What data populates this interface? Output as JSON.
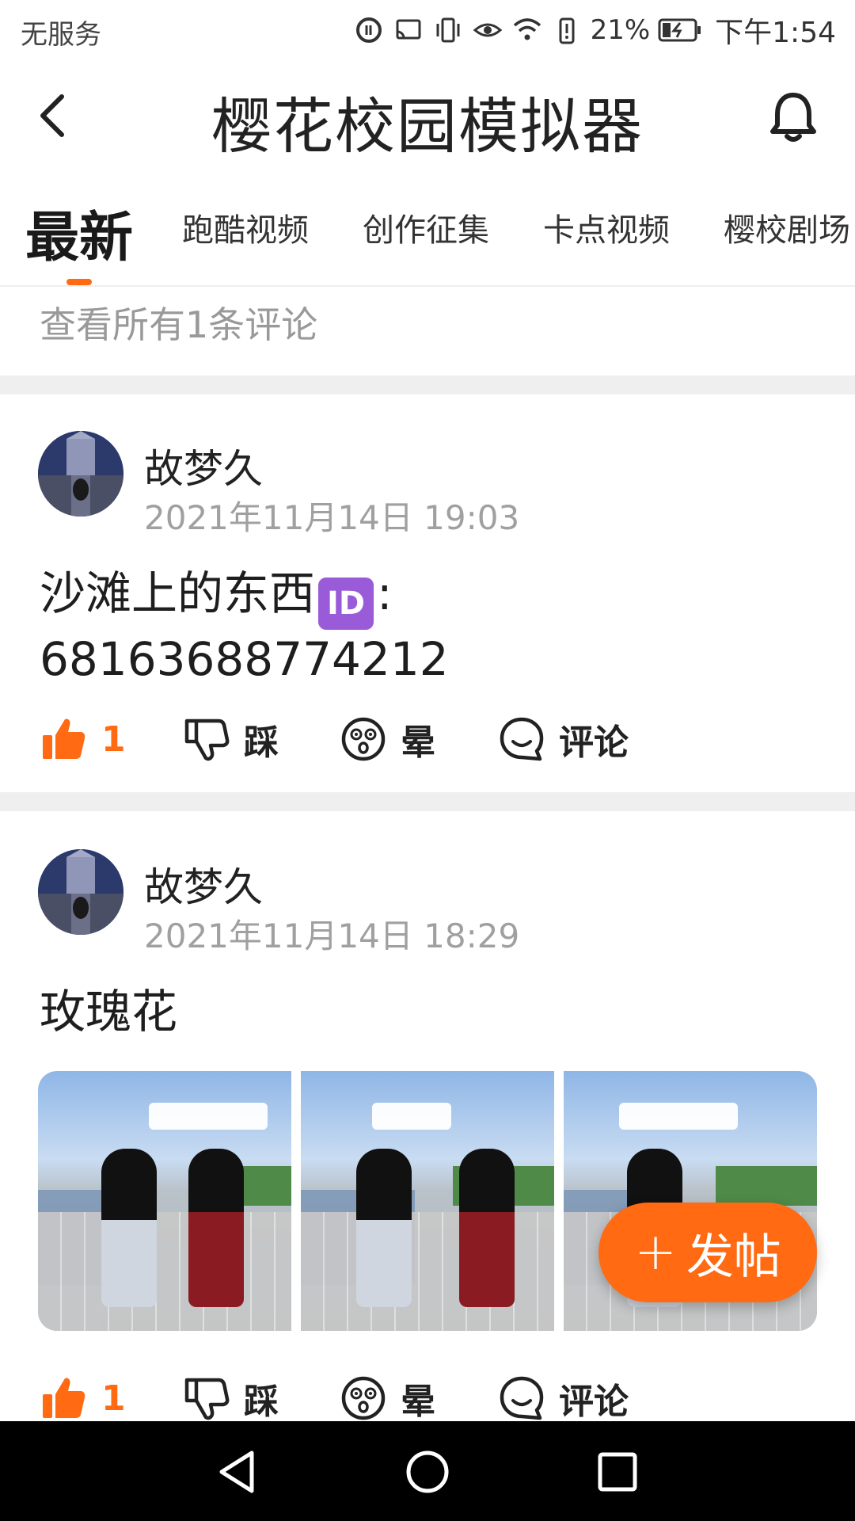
{
  "status_bar": {
    "carrier": "无服务",
    "battery": "21%",
    "time": "下午1:54"
  },
  "header": {
    "title": "樱花校园模拟器"
  },
  "tabs": [
    {
      "label": "最新",
      "active": true
    },
    {
      "label": "跑酷视频"
    },
    {
      "label": "创作征集"
    },
    {
      "label": "卡点视频"
    },
    {
      "label": "樱校剧场"
    }
  ],
  "feed": {
    "view_all_comments": "查看所有1条评论",
    "posts": [
      {
        "username": "故梦久",
        "timestamp": "2021年11月14日 19:03",
        "content_line1_prefix": "沙滩上的东西",
        "content_badge": "ID",
        "content_line1_suffix": ":",
        "content_line2": "68163688774212",
        "actions": {
          "like_count": "1",
          "dislike": "踩",
          "dizzy": "晕",
          "comment": "评论"
        }
      },
      {
        "username": "故梦久",
        "timestamp": "2021年11月14日 18:29",
        "content": "玫瑰花",
        "image_count": 3,
        "actions": {
          "like_count": "1",
          "dislike": "踩",
          "dizzy": "晕",
          "comment": "评论"
        }
      }
    ]
  },
  "fab": {
    "label": "发帖"
  },
  "colors": {
    "accent": "#ff6a13",
    "muted": "#a0a0a0",
    "divider": "#efefef"
  },
  "icons": [
    "back-arrow-icon",
    "bell-icon",
    "thumbs-up-icon",
    "thumbs-down-icon",
    "dizzy-face-icon",
    "comment-bubble-icon",
    "plus-icon",
    "nav-back-icon",
    "nav-home-icon",
    "nav-recents-icon"
  ]
}
